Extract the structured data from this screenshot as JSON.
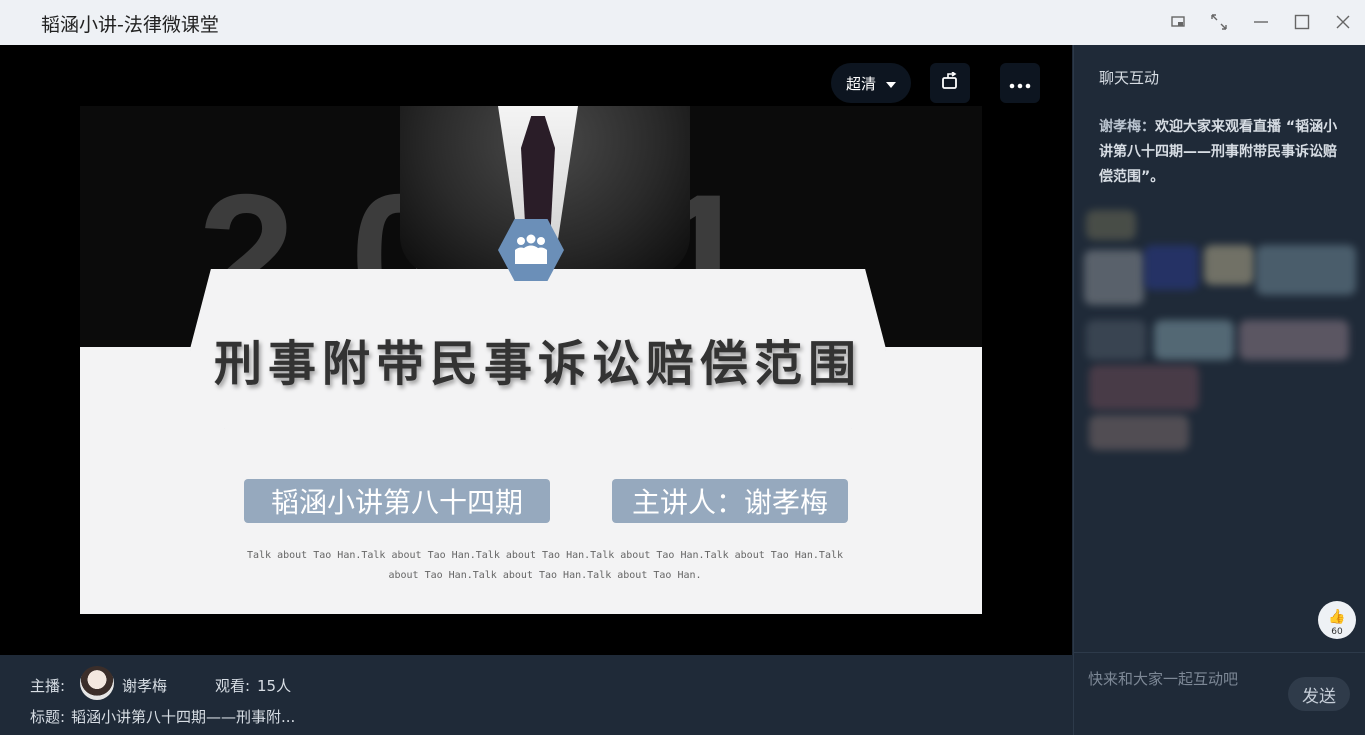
{
  "window": {
    "title": "韬涵小讲-法律微课堂"
  },
  "player": {
    "quality_label": "超清"
  },
  "slide": {
    "year": "2021",
    "title": "刑事附带民事诉讼赔偿范围",
    "series_label": "韬涵小讲第八十四期",
    "speaker_label": "主讲人：谢孝梅",
    "tagline": "Talk about Tao Han.Talk about Tao Han.Talk about Tao Han.Talk about Tao Han.Talk about Tao Han.Talk about Tao Han.Talk about Tao Han.Talk about Tao Han."
  },
  "chat": {
    "header": "聊天互动",
    "message_author": "谢孝梅：",
    "message_text": "欢迎大家来观看直播 “韬涵小讲第八十四期——刑事附带民事诉讼赔偿范围”。",
    "input_placeholder": "快来和大家一起互动吧",
    "send_label": "发送",
    "like_count": "60"
  },
  "info": {
    "host_label": "主播:",
    "host_name": "谢孝梅",
    "viewers_label": "观看:",
    "viewers_value": "15人",
    "title_label": "标题:",
    "title_value": "韬涵小讲第八十四期——刑事附..."
  }
}
